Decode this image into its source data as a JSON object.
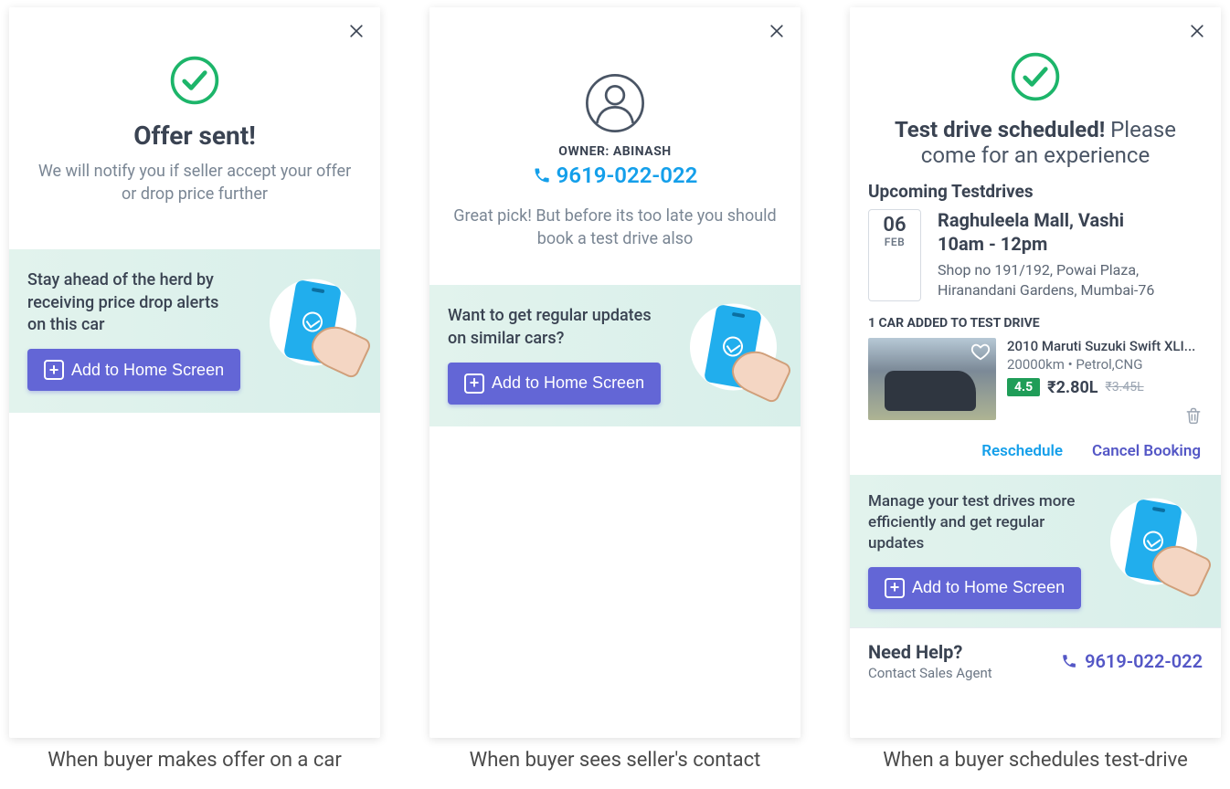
{
  "cards": {
    "offer": {
      "title": "Offer sent!",
      "subtitle": "We will notify you if seller accept your offer or drop price further",
      "banner_text": "Stay ahead of the herd by receiving price drop alerts on this car",
      "cta": "Add to Home Screen",
      "caption": "When buyer makes offer on a car"
    },
    "contact": {
      "owner_label": "OWNER: ABINASH",
      "owner_phone": "9619-022-022",
      "subtitle": "Great pick! But before its too late you should book a test drive also",
      "banner_text": "Want to get regular updates on similar cars?",
      "cta": "Add to Home Screen",
      "caption": "When buyer sees seller's contact"
    },
    "testdrive": {
      "title_bold": "Test drive scheduled!",
      "title_light": " Please come for an experience",
      "upcoming_label": "Upcoming Testdrives",
      "date_day": "06",
      "date_month": "FEB",
      "location": "Raghuleela Mall, Vashi",
      "time": "10am - 12pm",
      "address": "Shop no 191/192, Powai Plaza, Hiranandani Gardens, Mumbai-76",
      "added_label": "1 CAR ADDED TO TEST DRIVE",
      "car_title": "2010 Maruti Suzuki Swift XLI...",
      "car_sub": "20000km • Petrol,CNG",
      "rating": "4.5",
      "price": "₹2.80L",
      "old_price": "₹3.45L",
      "reschedule": "Reschedule",
      "cancel": "Cancel Booking",
      "banner_text": "Manage your test drives more efficiently and get regular updates",
      "cta": "Add to Home Screen",
      "help_title": "Need Help?",
      "help_sub": "Contact Sales Agent",
      "help_phone": "9619-022-022",
      "caption": "When a buyer schedules test-drive"
    }
  }
}
